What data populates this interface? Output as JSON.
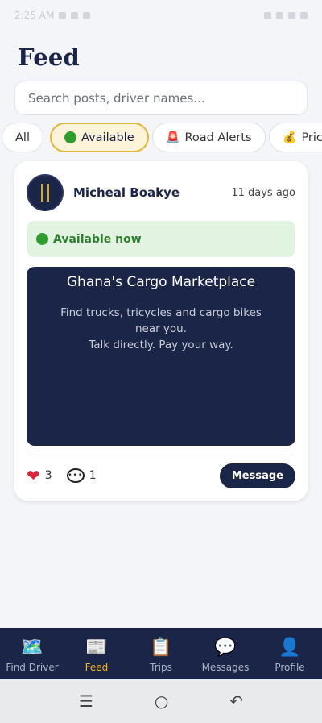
{
  "status": {
    "time": "2:25 AM"
  },
  "page": {
    "title": "Feed"
  },
  "search": {
    "placeholder": "Search posts, driver names..."
  },
  "filters": [
    {
      "label": "All",
      "emoji": ""
    },
    {
      "label": "Available",
      "emoji": "🟢"
    },
    {
      "label": "Road Alerts",
      "emoji": "🚨"
    },
    {
      "label": "Pric",
      "emoji": "💰"
    }
  ],
  "post": {
    "author": "Micheal Boakye",
    "time": "11 days ago",
    "status": "Available now",
    "media": {
      "title": "Ghana's Cargo Marketplace",
      "line1": "Find trucks, tricycles and cargo bikes near you.",
      "line2": "Talk directly. Pay your way."
    },
    "likes": "3",
    "comments": "1",
    "message_label": "Message"
  },
  "nav": [
    {
      "label": "Find Driver",
      "icon": "map-icon"
    },
    {
      "label": "Feed",
      "icon": "newspaper-icon"
    },
    {
      "label": "Trips",
      "icon": "clipboard-icon"
    },
    {
      "label": "Messages",
      "icon": "speech-bubble-icon"
    },
    {
      "label": "Profile",
      "icon": "user-icon"
    }
  ],
  "colors": {
    "primary": "#1b2547",
    "accent": "#f2b51d",
    "success": "#2f7d32"
  }
}
